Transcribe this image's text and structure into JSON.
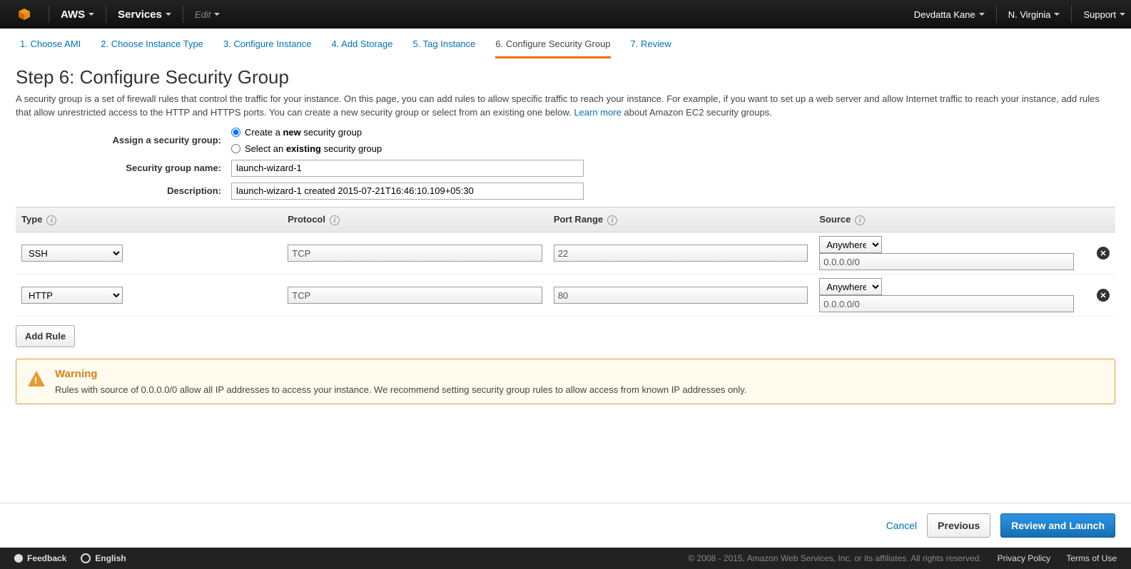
{
  "nav": {
    "aws": "AWS",
    "services": "Services",
    "edit": "Edit",
    "user": "Devdatta Kane",
    "region": "N. Virginia",
    "support": "Support"
  },
  "wizard": {
    "steps": [
      "1. Choose AMI",
      "2. Choose Instance Type",
      "3. Configure Instance",
      "4. Add Storage",
      "5. Tag Instance",
      "6. Configure Security Group",
      "7. Review"
    ]
  },
  "page": {
    "title": "Step 6: Configure Security Group",
    "desc_a": "A security group is a set of firewall rules that control the traffic for your instance. On this page, you can add rules to allow specific traffic to reach your instance. For example, if you want to set up a web server and allow Internet traffic to reach your instance, add rules that allow unrestricted access to the HTTP and HTTPS ports. You can create a new security group or select from an existing one below. ",
    "learn_more": "Learn more",
    "desc_b": " about Amazon EC2 security groups."
  },
  "form": {
    "assign_label": "Assign a security group:",
    "create_a": "Create a ",
    "create_b": "new",
    "create_c": " security group",
    "existing_a": "Select an ",
    "existing_b": "existing",
    "existing_c": " security group",
    "name_label": "Security group name:",
    "name_value": "launch-wizard-1",
    "desc_label": "Description:",
    "desc_value": "launch-wizard-1 created 2015-07-21T16:46:10.109+05:30"
  },
  "table": {
    "headers": {
      "type": "Type",
      "protocol": "Protocol",
      "port": "Port Range",
      "source": "Source"
    },
    "rows": [
      {
        "type": "SSH",
        "protocol": "TCP",
        "port": "22",
        "src_sel": "Anywhere",
        "src_ip": "0.0.0.0/0"
      },
      {
        "type": "HTTP",
        "protocol": "TCP",
        "port": "80",
        "src_sel": "Anywhere",
        "src_ip": "0.0.0.0/0"
      }
    ],
    "add_rule": "Add Rule"
  },
  "warning": {
    "title": "Warning",
    "text": "Rules with source of 0.0.0.0/0 allow all IP addresses to access your instance. We recommend setting security group rules to allow access from known IP addresses only."
  },
  "footer": {
    "cancel": "Cancel",
    "previous": "Previous",
    "launch": "Review and Launch"
  },
  "bottom": {
    "feedback": "Feedback",
    "english": "English",
    "copyright": "© 2008 - 2015, Amazon Web Services, Inc. or its affiliates. All rights reserved.",
    "privacy": "Privacy Policy",
    "terms": "Terms of Use"
  }
}
